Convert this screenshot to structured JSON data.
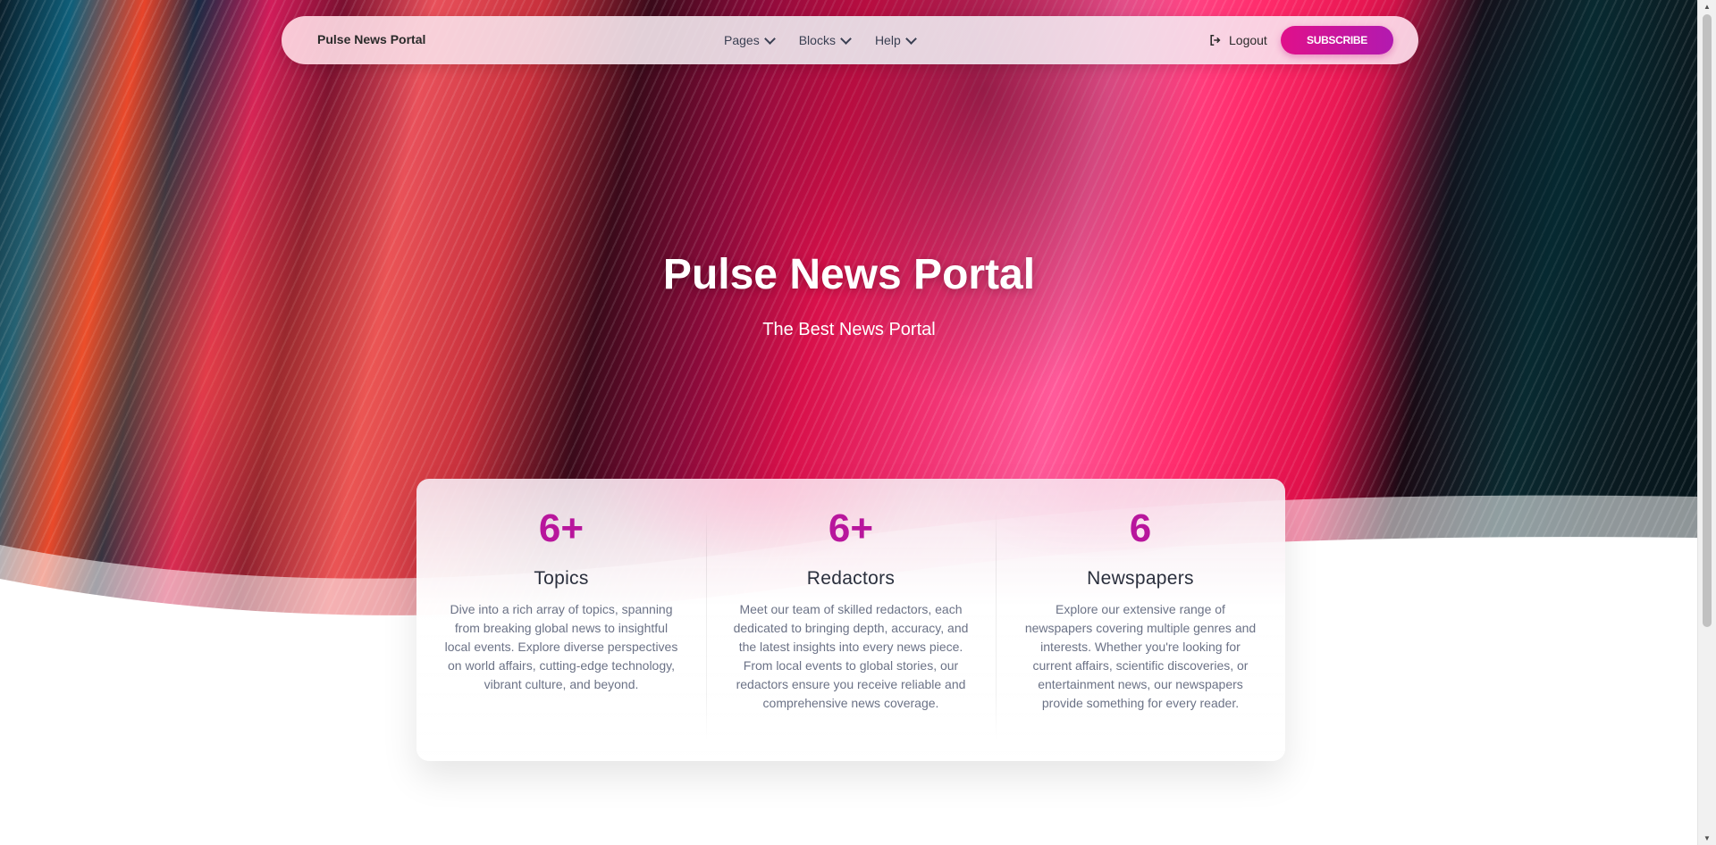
{
  "navbar": {
    "brand": "Pulse News Portal",
    "menu": [
      {
        "label": "Pages"
      },
      {
        "label": "Blocks"
      },
      {
        "label": "Help"
      }
    ],
    "logout_label": "Logout",
    "subscribe_label": "SUBSCRIBE"
  },
  "hero": {
    "title": "Pulse News Portal",
    "subtitle": "The Best News Portal"
  },
  "stats": [
    {
      "value": "6+",
      "title": "Topics",
      "description": "Dive into a rich array of topics, spanning from breaking global news to insightful local events. Explore diverse perspectives on world affairs, cutting-edge technology, vibrant culture, and beyond."
    },
    {
      "value": "6+",
      "title": "Redactors",
      "description": "Meet our team of skilled redactors, each dedicated to bringing depth, accuracy, and the latest insights into every news piece. From local events to global stories, our redactors ensure you receive reliable and comprehensive news coverage."
    },
    {
      "value": "6",
      "title": "Newspapers",
      "description": "Explore our extensive range of newspapers covering multiple genres and interests. Whether you're looking for current affairs, scientific discoveries, or entertainment news, our newspapers provide something for every reader."
    }
  ],
  "colors": {
    "accent": "#b8169c",
    "button_start": "#e0108a",
    "button_end": "#b21ab0"
  }
}
